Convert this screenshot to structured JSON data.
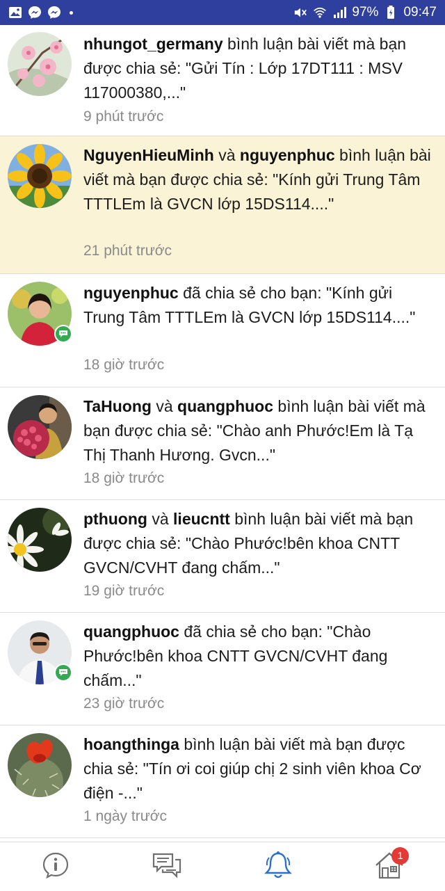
{
  "status_bar": {
    "battery": "97%",
    "time": "09:47",
    "icons": [
      "gallery-icon",
      "messenger-icon",
      "messenger-icon",
      "mute-icon",
      "wifi-icon",
      "signal-icon",
      "battery-icon"
    ]
  },
  "notifications": [
    {
      "actors": [
        {
          "name": "nhungot_germany"
        }
      ],
      "joiner": "",
      "message": "bình luận bài viết mà bạn được chia sẻ: \"Gửi Tín : Lớp 17DT111 : MSV 117000380,...\"",
      "time": "9 phút trước",
      "highlighted": false,
      "has_badge": false,
      "avatar": "cherry-blossom"
    },
    {
      "actors": [
        {
          "name": "NguyenHieuMinh"
        },
        {
          "name": "nguyenphuc"
        }
      ],
      "joiner": "và",
      "message": "bình luận bài viết mà bạn được chia sẻ: \"Kính gửi Trung Tâm TTTLEm là GVCN lớp 15DS114....\"",
      "time": "21 phút trước",
      "highlighted": true,
      "has_badge": false,
      "avatar": "sunflower"
    },
    {
      "actors": [
        {
          "name": "nguyenphuc"
        }
      ],
      "joiner": "",
      "message": "đã chia sẻ cho bạn: \"Kính gửi Trung Tâm TTTLEm là GVCN lớp 15DS114....\"",
      "time": "18 giờ trước",
      "highlighted": false,
      "has_badge": true,
      "avatar": "woman-portrait"
    },
    {
      "actors": [
        {
          "name": "TaHuong"
        },
        {
          "name": "quangphuoc"
        }
      ],
      "joiner": "và",
      "message": "bình luận bài viết mà bạn được chia sẻ: \"Chào anh Phước!Em là Tạ Thị Thanh Hương. Gvcn...\"",
      "time": "18 giờ trước",
      "highlighted": false,
      "has_badge": false,
      "avatar": "flower-bouquet"
    },
    {
      "actors": [
        {
          "name": "pthuong"
        },
        {
          "name": "lieucntt"
        }
      ],
      "joiner": "và",
      "message": "bình luận bài viết mà bạn được chia sẻ: \"Chào Phước!bên khoa CNTT GVCN/CVHT đang chấm...\"",
      "time": "19 giờ trước",
      "highlighted": false,
      "has_badge": false,
      "avatar": "white-daisy"
    },
    {
      "actors": [
        {
          "name": "quangphuoc"
        }
      ],
      "joiner": "",
      "message": "đã chia sẻ cho bạn: \"Chào Phước!bên khoa CNTT GVCN/CVHT đang chấm...\"",
      "time": "23 giờ trước",
      "highlighted": false,
      "has_badge": true,
      "avatar": "man-portrait"
    },
    {
      "actors": [
        {
          "name": "hoangthinga"
        }
      ],
      "joiner": "",
      "message": "bình luận bài viết mà bạn được chia sẻ: \"Tín ơi coi giúp chị 2 sinh viên khoa Cơ điện -...\"",
      "time": "1 ngày trước",
      "highlighted": false,
      "has_badge": false,
      "avatar": "red-cactus-flower"
    }
  ],
  "bottom_nav": {
    "items": [
      {
        "icon": "info-icon",
        "active": false
      },
      {
        "icon": "chat-icon",
        "active": false
      },
      {
        "icon": "bell-icon",
        "active": true
      },
      {
        "icon": "home-icon",
        "active": false,
        "badge": "1"
      }
    ]
  },
  "colors": {
    "status_bar": "#2f3f9e",
    "highlight_row": "#fbf3d6",
    "active_nav": "#2a6fd1",
    "badge_green": "#35a852",
    "badge_red": "#e53935"
  }
}
